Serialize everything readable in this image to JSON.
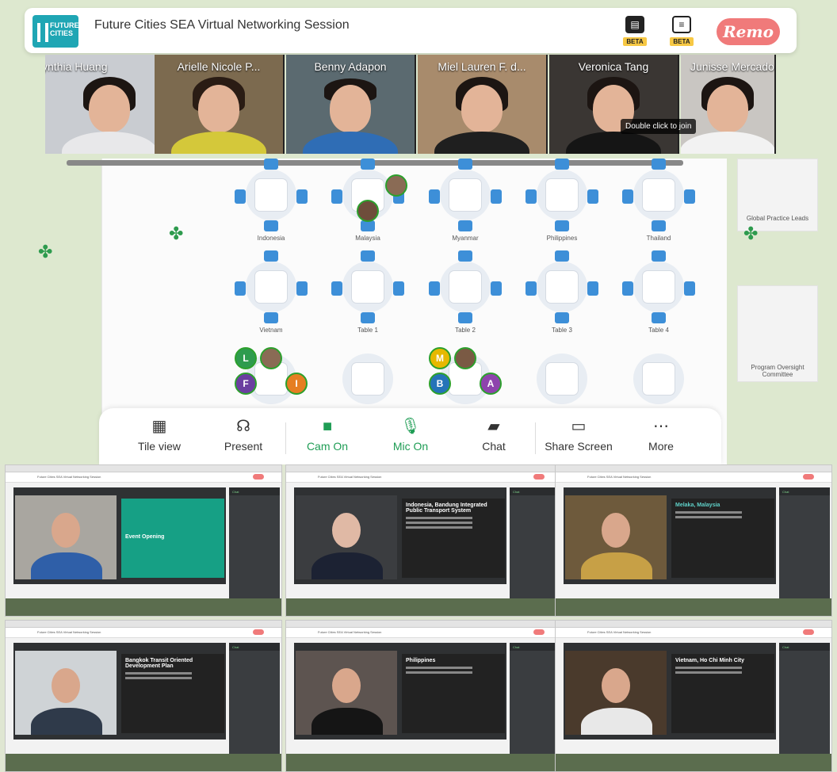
{
  "header": {
    "title": "Future Cities SEA Virtual Networking Session",
    "logo_text": "FUTURE CITIES",
    "beta_label": "BETA",
    "brand": "Remo"
  },
  "participants": [
    {
      "name": "ynthia Huang"
    },
    {
      "name": "Arielle Nicole P..."
    },
    {
      "name": "Benny Adapon"
    },
    {
      "name": "Miel Lauren F. d..."
    },
    {
      "name": "Veronica Tang"
    },
    {
      "name": "Junisse Mercado"
    }
  ],
  "tooltip": "Double click to join",
  "tables_row1": [
    "Indonesia",
    "Malaysia",
    "Myanmar",
    "Philippines",
    "Thailand"
  ],
  "tables_row2": [
    "Vietnam",
    "Table 1",
    "Table 2",
    "Table 3",
    "Table 4"
  ],
  "side_rooms": [
    "Global Practice Leads",
    "Program Oversight Committee"
  ],
  "avatars": [
    "L",
    "F",
    "I",
    "M",
    "B",
    "A"
  ],
  "toolbar": {
    "tile_view": "Tile view",
    "present": "Present",
    "cam_on": "Cam On",
    "mic_on": "Mic On",
    "chat": "Chat",
    "share_screen": "Share Screen",
    "more": "More"
  },
  "screenshots": [
    {
      "slide_title": "Event Opening",
      "slide_bg": "#16a085"
    },
    {
      "slide_title": "Indonesia, Bandung Integrated Public Transport System",
      "slide_bg": "#222222"
    },
    {
      "slide_title": "Melaka, Malaysia",
      "slide_bg": "#222222"
    },
    {
      "slide_title": "Bangkok Transit Oriented Development Plan",
      "slide_bg": "#222222"
    },
    {
      "slide_title": "Philippines",
      "slide_bg": "#222222"
    },
    {
      "slide_title": "Vietnam, Ho Chi Minh City",
      "slide_bg": "#222222"
    }
  ],
  "colors": {
    "accent_green": "#1f9d55",
    "brand_red": "#f07a7a",
    "chair_blue": "#3d8fd8"
  }
}
